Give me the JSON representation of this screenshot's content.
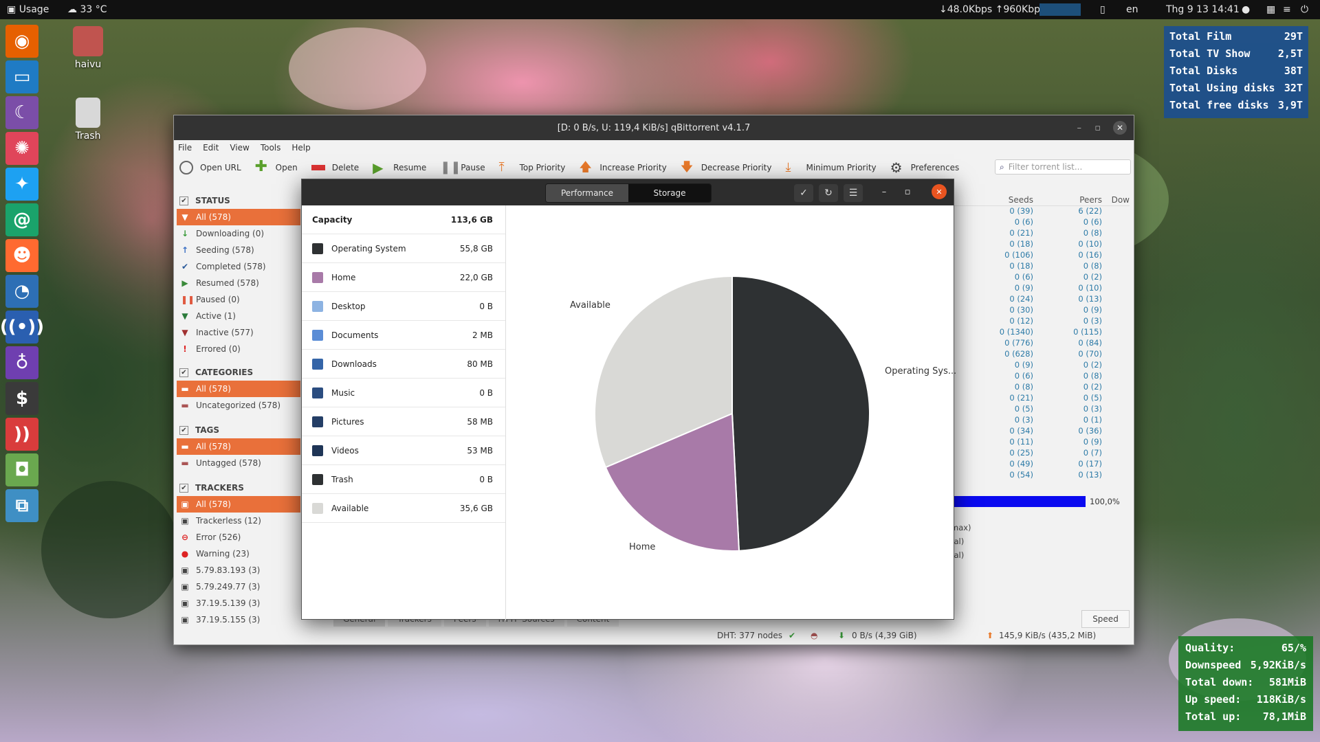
{
  "topbar": {
    "usage": "Usage",
    "temp": "33 °C",
    "net": "↓48.0Kbps ↑960Kbps",
    "lang": "en",
    "clock": "Thg 9 13  14:41"
  },
  "desktop": {
    "home_label": "haivu",
    "trash_label": "Trash"
  },
  "widget_top": {
    "rows": [
      {
        "label": "Total Film",
        "value": "29T"
      },
      {
        "label": "Total TV Show",
        "value": "2,5T"
      },
      {
        "label": "Total Disks",
        "value": "38T"
      },
      {
        "label": "Total Using disks",
        "value": "32T"
      },
      {
        "label": "Total free disks",
        "value": "3,9T"
      }
    ]
  },
  "widget_bottom": {
    "rows": [
      {
        "label": "Quality:",
        "value": "65/%"
      },
      {
        "label": "Downspeed",
        "value": "5,92KiB/s"
      },
      {
        "label": "Total down:",
        "value": "581MiB"
      },
      {
        "label": "Up speed:",
        "value": "118KiB/s"
      },
      {
        "label": "Total up:",
        "value": "78,1MiB"
      }
    ]
  },
  "qbt": {
    "title": "[D: 0 B/s, U: 119,4 KiB/s] qBittorrent v4.1.7",
    "menu": [
      "File",
      "Edit",
      "View",
      "Tools",
      "Help"
    ],
    "toolbar": {
      "open_url": "Open URL",
      "open": "Open",
      "delete": "Delete",
      "resume": "Resume",
      "pause": "Pause",
      "top_priority": "Top Priority",
      "increase_priority": "Increase Priority",
      "decrease_priority": "Decrease Priority",
      "minimum_priority": "Minimum Priority",
      "preferences": "Preferences"
    },
    "filter_placeholder": "Filter torrent list...",
    "status_header": "STATUS",
    "status": [
      "All (578)",
      "Downloading (0)",
      "Seeding (578)",
      "Completed (578)",
      "Resumed (578)",
      "Paused (0)",
      "Active (1)",
      "Inactive (577)",
      "Errored (0)"
    ],
    "categories_header": "CATEGORIES",
    "categories": [
      "All (578)",
      "Uncategorized (578)"
    ],
    "tags_header": "TAGS",
    "tags": [
      "All (578)",
      "Untagged (578)"
    ],
    "trackers_header": "TRACKERS",
    "trackers": [
      "All (578)",
      "Trackerless (12)",
      "Error (526)",
      "Warning (23)",
      "5.79.83.193 (3)",
      "5.79.249.77 (3)",
      "37.19.5.139 (3)",
      "37.19.5.155 (3)"
    ],
    "cols": {
      "seeds": "Seeds",
      "peers": "Peers",
      "down": "Dow"
    },
    "rows": [
      [
        "0 (39)",
        "6 (22)"
      ],
      [
        "0 (6)",
        "0 (6)"
      ],
      [
        "0 (21)",
        "0 (8)"
      ],
      [
        "0 (18)",
        "0 (10)"
      ],
      [
        "0 (106)",
        "0 (16)"
      ],
      [
        "0 (18)",
        "0 (8)"
      ],
      [
        "0 (6)",
        "0 (2)"
      ],
      [
        "0 (9)",
        "0 (10)"
      ],
      [
        "0 (24)",
        "0 (13)"
      ],
      [
        "0 (30)",
        "0 (9)"
      ],
      [
        "0 (12)",
        "0 (3)"
      ],
      [
        "0 (1340)",
        "0 (115)"
      ],
      [
        "0 (776)",
        "0 (84)"
      ],
      [
        "0 (628)",
        "0 (70)"
      ],
      [
        "0 (9)",
        "0 (2)"
      ],
      [
        "0 (6)",
        "0 (8)"
      ],
      [
        "0 (8)",
        "0 (2)"
      ],
      [
        "0 (21)",
        "0 (5)"
      ],
      [
        "0 (5)",
        "0 (3)"
      ],
      [
        "0 (3)",
        "0 (1)"
      ],
      [
        "0 (34)",
        "0 (36)"
      ],
      [
        "0 (11)",
        "0 (9)"
      ],
      [
        "0 (25)",
        "0 (7)"
      ],
      [
        "0 (49)",
        "0 (17)"
      ],
      [
        "0 (54)",
        "0 (13)"
      ]
    ],
    "progress": {
      "value": 1.0,
      "text": "100,0%"
    },
    "frag": [
      "max)",
      "tal)",
      "tal)"
    ],
    "tabs": [
      "General",
      "Trackers",
      "Peers",
      "HTTP Sources",
      "Content"
    ],
    "speed_button": "Speed",
    "statusbar": {
      "dht": "DHT: 377 nodes",
      "down": "0 B/s (4,39 GiB)",
      "up": "145,9 KiB/s (435,2 MiB)"
    }
  },
  "dialog": {
    "tabs": {
      "performance": "Performance",
      "storage": "Storage"
    },
    "capacity_label": "Capacity",
    "capacity_value": "113,6 GB",
    "items": [
      {
        "name": "Operating System",
        "value": "55,8 GB",
        "color": "#2e3133"
      },
      {
        "name": "Home",
        "value": "22,0 GB",
        "color": "#a87aa8"
      },
      {
        "name": "Desktop",
        "value": "0 B",
        "color": "#8db3e2"
      },
      {
        "name": "Documents",
        "value": "2 MB",
        "color": "#5b8dd6"
      },
      {
        "name": "Downloads",
        "value": "80 MB",
        "color": "#3565a8"
      },
      {
        "name": "Music",
        "value": "0 B",
        "color": "#2b4d80"
      },
      {
        "name": "Pictures",
        "value": "58 MB",
        "color": "#243e66"
      },
      {
        "name": "Videos",
        "value": "53 MB",
        "color": "#1f3556"
      },
      {
        "name": "Trash",
        "value": "0 B",
        "color": "#2e3133"
      },
      {
        "name": "Available",
        "value": "35,6 GB",
        "color": "#d9d9d6"
      }
    ],
    "pie_labels": {
      "available": "Available",
      "os": "Operating Sys...",
      "home": "Home"
    }
  },
  "chart_data": {
    "type": "pie",
    "labels": [
      "Operating System",
      "Home",
      "Available"
    ],
    "values": [
      55.8,
      22.0,
      35.6
    ],
    "colors": [
      "#2e3133",
      "#a87aa8",
      "#d9d9d6"
    ]
  }
}
